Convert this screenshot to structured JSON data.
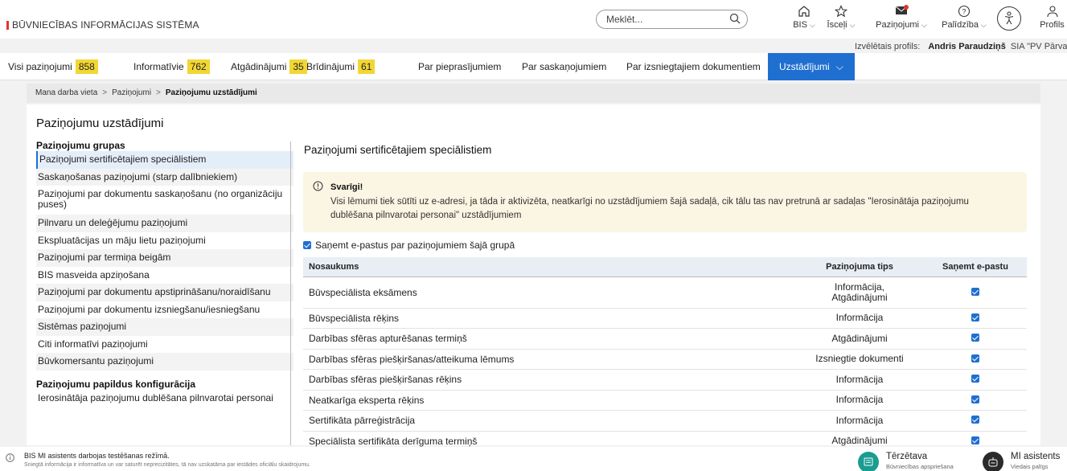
{
  "header": {
    "brand": "BŪVNIECĪBAS INFORMĀCIJAS SISTĒMA",
    "search_placeholder": "Meklēt...",
    "nav": [
      {
        "label": "BIS",
        "icon": "home-icon"
      },
      {
        "label": "Īsceļi",
        "icon": "star-icon"
      },
      {
        "label": "Paziņojumi",
        "icon": "envelope-icon"
      },
      {
        "label": "Palīdzība",
        "icon": "help-icon"
      },
      {
        "label": "Profils",
        "icon": "user-icon"
      }
    ],
    "accessibility_icon": "accessibility-icon"
  },
  "profile": {
    "label": "Izvēlētais profils:",
    "name": "Andris Paraudziņš",
    "org": "SIA \"PV Pārvalde"
  },
  "tabs": [
    {
      "label": "Visi paziņojumi",
      "count": "858"
    },
    {
      "label": "Informatīvie",
      "count": "762"
    },
    {
      "label": "Atgādinājumi",
      "count": "35"
    },
    {
      "label": "Brīdinājumi",
      "count": "61"
    },
    {
      "label": "Par pieprasījumiem",
      "count": ""
    },
    {
      "label": "Par saskaņojumiem",
      "count": ""
    },
    {
      "label": "Par izsniegtajiem dokumentiem",
      "count": ""
    },
    {
      "label": "Uzstādījumi",
      "count": ""
    }
  ],
  "breadcrumb": [
    "Mana darba vieta",
    "Paziņojumi",
    "Paziņojumu uzstādījumi"
  ],
  "page_title": "Paziņojumu uzstādījumi",
  "left": {
    "groups_title": "Paziņojumu grupas",
    "items": [
      "Paziņojumi sertificētajiem speciālistiem",
      "Saskaņošanas paziņojumi (starp dalībniekiem)",
      "Paziņojumi par dokumentu saskaņošanu (no organizāciju puses)",
      "Pilnvaru un deleģējumu paziņojumi",
      "Ekspluatācijas un māju lietu paziņojumi",
      "Paziņojumi par termiņa beigām",
      "BIS masveida apziņošana",
      "Paziņojumi par dokumentu apstiprināšanu/noraidīšanu",
      "Paziņojumi par dokumentu izsniegšanu/iesniegšanu",
      "Sistēmas paziņojumi",
      "Citi informatīvi paziņojumi",
      "Būvkomersantu paziņojumi"
    ],
    "extra_title": "Paziņojumu papildus konfigurācija",
    "extra_items": [
      "Ierosinātāja paziņojumu dublēšana pilnvarotai personai"
    ]
  },
  "right": {
    "section_title": "Paziņojumi sertificētajiem speciālistiem",
    "alert_title": "Svarīgi!",
    "alert_text": "Visi lēmumi tiek sūtīti uz e-adresi, ja tāda ir aktivizēta, neatkarīgi no uzstādījumiem šajā sadaļā, cik tālu tas nav pretrunā ar sadaļas \"Ierosinātāja paziņojumu dublēšana pilnvarotai personai\" uzstādījumiem",
    "email_group_label": "Saņemt e-pastus par paziņojumiem šajā grupā",
    "email_group_checked": true,
    "columns": [
      "Nosaukums",
      "Paziņojuma tips",
      "Saņemt e-pastu"
    ],
    "rows": [
      {
        "name": "Būvspeciālista eksāmens",
        "type": "Informācija,\nAtgādinājumi",
        "email": true
      },
      {
        "name": "Būvspeciālista rēķins",
        "type": "Informācija",
        "email": true
      },
      {
        "name": "Darbības sfēras apturēšanas termiņš",
        "type": "Atgādinājumi",
        "email": true
      },
      {
        "name": "Darbības sfēras piešķiršanas/atteikuma lēmums",
        "type": "Izsniegtie dokumenti",
        "email": true
      },
      {
        "name": "Darbības sfēras piešķiršanas rēķins",
        "type": "Informācija",
        "email": true
      },
      {
        "name": "Neatkarīga eksperta rēķins",
        "type": "Informācija",
        "email": true
      },
      {
        "name": "Sertifikāta pārreģistrācija",
        "type": "Informācija",
        "email": true
      },
      {
        "name": "Speciālista sertifikāta derīguma termiņš",
        "type": "Atgādinājumi",
        "email": true
      }
    ]
  },
  "footer": {
    "notice_title": "BIS MI asistents darbojas testēšanas režīmā.",
    "notice_sub": "Sniegtā informācija ir informatīva un var saturēt neprecizitātes, tā nav uzskatāma par iestādes oficiālu skaidrojumu.",
    "chat1_title": "Tērzētava",
    "chat1_sub": "Būvniecības apspriešana",
    "chat2_title": "MI asistents",
    "chat2_sub": "Viedais palīgs"
  },
  "colors": {
    "accent": "#1f6fd0",
    "count_badge": "#f2d634",
    "alert_bg": "#fbf5e3",
    "brand_mark": "#e3342f"
  }
}
